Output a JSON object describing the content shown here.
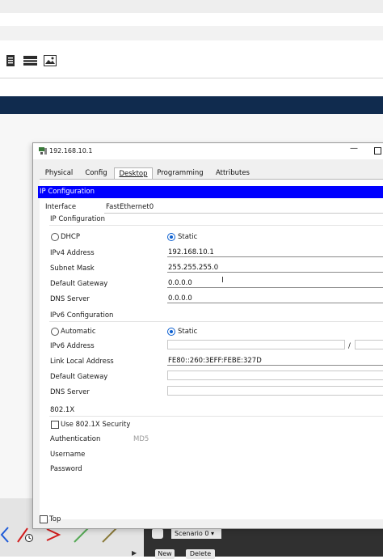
{
  "colors": {
    "navy_bar": "#102b4e",
    "ip_header": "#0000ff",
    "accent_radio": "#0b5fd0"
  },
  "toolbar_icons": [
    "notes-icon",
    "device-list-icon",
    "image-icon"
  ],
  "dialog": {
    "title": "192.168.10.1",
    "tabs": [
      {
        "label": "Physical"
      },
      {
        "label": "Config"
      },
      {
        "label": "Desktop",
        "active": true
      },
      {
        "label": "Programming"
      },
      {
        "label": "Attributes"
      }
    ],
    "header": "IP Configuration",
    "interface_label": "Interface",
    "interface_value": "FastEthernet0",
    "ipv4": {
      "section": "IP Configuration",
      "dhcp_label": "DHCP",
      "static_label": "Static",
      "selected": "Static",
      "address_label": "IPv4 Address",
      "address": "192.168.10.1",
      "mask_label": "Subnet Mask",
      "mask": "255.255.255.0",
      "gateway_label": "Default Gateway",
      "gateway": "0.0.0.0",
      "dns_label": "DNS Server",
      "dns": "0.0.0.0"
    },
    "ipv6": {
      "section": "IPv6 Configuration",
      "auto_label": "Automatic",
      "static_label": "Static",
      "selected": "Static",
      "address_label": "IPv6 Address",
      "address": "",
      "prefix_sep": "/",
      "prefix": "",
      "link_local_label": "Link Local Address",
      "link_local": "FE80::260:3EFF:FEBE:327D",
      "gateway_label": "Default Gateway",
      "gateway": "",
      "dns_label": "DNS Server",
      "dns": ""
    },
    "dot1x": {
      "section": "802.1X",
      "use_label": "Use 802.1X Security",
      "use_checked": false,
      "auth_label": "Authentication",
      "auth_value": "MD5",
      "user_label": "Username",
      "username": "",
      "pass_label": "Password",
      "password": ""
    },
    "top_label": "Top",
    "top_checked": false
  },
  "bottom": {
    "scenario": "Scenario 0",
    "new_label": "New",
    "delete_label": "Delete"
  }
}
